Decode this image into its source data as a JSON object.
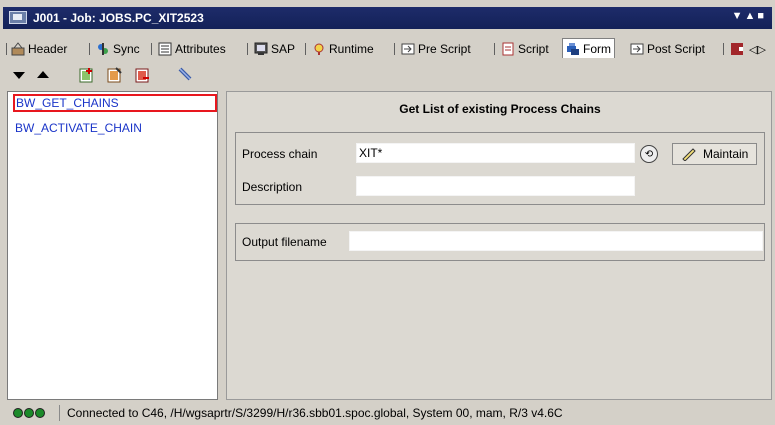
{
  "window": {
    "title": "J001 - Job: JOBS.PC_XIT2523",
    "controls": "▼▲■"
  },
  "tabs": [
    {
      "label": "Header",
      "icon": "header-icon"
    },
    {
      "label": "Sync",
      "icon": "sync-icon"
    },
    {
      "label": "Attributes",
      "icon": "attributes-icon"
    },
    {
      "label": "SAP",
      "icon": "sap-icon"
    },
    {
      "label": "Runtime",
      "icon": "runtime-icon"
    },
    {
      "label": "Pre Script",
      "icon": "pre-script-icon"
    },
    {
      "label": "Script",
      "icon": "script-icon"
    },
    {
      "label": "Form",
      "icon": "form-icon",
      "active": true
    },
    {
      "label": "Post Script",
      "icon": "post-script-icon"
    }
  ],
  "tab_scroll": "◁▷",
  "toolbar": [
    "move-down-icon",
    "move-up-icon",
    "add-icon",
    "edit-icon",
    "delete-icon",
    "tool-icon"
  ],
  "left_list": {
    "items": [
      "BW_GET_CHAINS",
      "BW_ACTIVATE_CHAIN"
    ],
    "selected": 0
  },
  "form": {
    "title": "Get List of existing Process Chains",
    "process_chain_label": "Process chain",
    "process_chain_value": "XIT*",
    "description_label": "Description",
    "description_value": "",
    "maintain_label": "Maintain",
    "output_filename_label": "Output filename",
    "output_filename_value": ""
  },
  "status": {
    "text": "Connected to C46, /H/wgsaprtr/S/3299/H/r36.sbb01.spoc.global, System 00, mam, R/3 v4.6C",
    "led_colors": [
      "#1c8a2a",
      "#1c8a2a",
      "#1c8a2a"
    ]
  },
  "colors": {
    "titlebar": "#132158",
    "list_text": "#1a34c8",
    "selection_border": "#e8171e"
  }
}
